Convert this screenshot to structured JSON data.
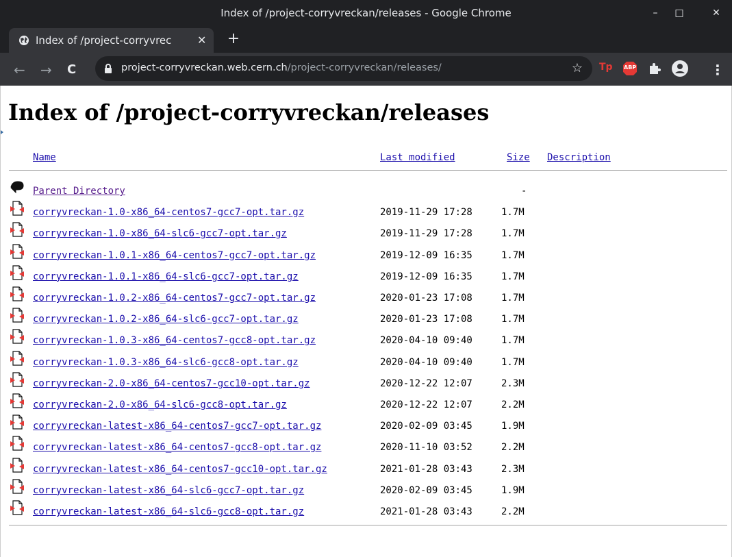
{
  "window": {
    "title": "Index of /project-corryvreckan/releases - Google Chrome",
    "controls": {
      "minimize": "–",
      "maximize": "□",
      "close": "✕"
    }
  },
  "tab": {
    "title": "Index of /project-corryvrec",
    "close": "✕",
    "new_tab": "+"
  },
  "toolbar": {
    "back": "←",
    "forward": "→",
    "reload": "C",
    "url_host": "project-corryvreckan.web.cern.ch",
    "url_path": "/project-corryvreckan/releases/",
    "bookmark_star": "☆",
    "extensions": [
      "Tp",
      "ABP"
    ],
    "menu": "⋮"
  },
  "page": {
    "heading": "Index of /project-corryvreckan/releases",
    "columns": {
      "name": "Name",
      "last_modified": "Last modified",
      "size": "Size",
      "description": "Description"
    },
    "parent": {
      "name": "Parent Directory",
      "size": "-"
    },
    "rows": [
      {
        "name": "corryvreckan-1.0-x86_64-centos7-gcc7-opt.tar.gz",
        "modified": "2019-11-29 17:28",
        "size": "1.7M"
      },
      {
        "name": "corryvreckan-1.0-x86_64-slc6-gcc7-opt.tar.gz",
        "modified": "2019-11-29 17:28",
        "size": "1.7M"
      },
      {
        "name": "corryvreckan-1.0.1-x86_64-centos7-gcc7-opt.tar.gz",
        "modified": "2019-12-09 16:35",
        "size": "1.7M"
      },
      {
        "name": "corryvreckan-1.0.1-x86_64-slc6-gcc7-opt.tar.gz",
        "modified": "2019-12-09 16:35",
        "size": "1.7M"
      },
      {
        "name": "corryvreckan-1.0.2-x86_64-centos7-gcc7-opt.tar.gz",
        "modified": "2020-01-23 17:08",
        "size": "1.7M"
      },
      {
        "name": "corryvreckan-1.0.2-x86_64-slc6-gcc7-opt.tar.gz",
        "modified": "2020-01-23 17:08",
        "size": "1.7M"
      },
      {
        "name": "corryvreckan-1.0.3-x86_64-centos7-gcc8-opt.tar.gz",
        "modified": "2020-04-10 09:40",
        "size": "1.7M"
      },
      {
        "name": "corryvreckan-1.0.3-x86_64-slc6-gcc8-opt.tar.gz",
        "modified": "2020-04-10 09:40",
        "size": "1.7M"
      },
      {
        "name": "corryvreckan-2.0-x86_64-centos7-gcc10-opt.tar.gz",
        "modified": "2020-12-22 12:07",
        "size": "2.3M"
      },
      {
        "name": "corryvreckan-2.0-x86_64-slc6-gcc8-opt.tar.gz",
        "modified": "2020-12-22 12:07",
        "size": "2.2M"
      },
      {
        "name": "corryvreckan-latest-x86_64-centos7-gcc7-opt.tar.gz",
        "modified": "2020-02-09 03:45",
        "size": "1.9M"
      },
      {
        "name": "corryvreckan-latest-x86_64-centos7-gcc8-opt.tar.gz",
        "modified": "2020-11-10 03:52",
        "size": "2.2M"
      },
      {
        "name": "corryvreckan-latest-x86_64-centos7-gcc10-opt.tar.gz",
        "modified": "2021-01-28 03:43",
        "size": "2.3M"
      },
      {
        "name": "corryvreckan-latest-x86_64-slc6-gcc7-opt.tar.gz",
        "modified": "2020-02-09 03:45",
        "size": "1.9M"
      },
      {
        "name": "corryvreckan-latest-x86_64-slc6-gcc8-opt.tar.gz",
        "modified": "2021-01-28 03:43",
        "size": "2.2M"
      }
    ]
  },
  "colors": {
    "link": "#1a0dab",
    "visited": "#551a8b",
    "chrome_dark": "#202124",
    "toolbar": "#35363a"
  }
}
